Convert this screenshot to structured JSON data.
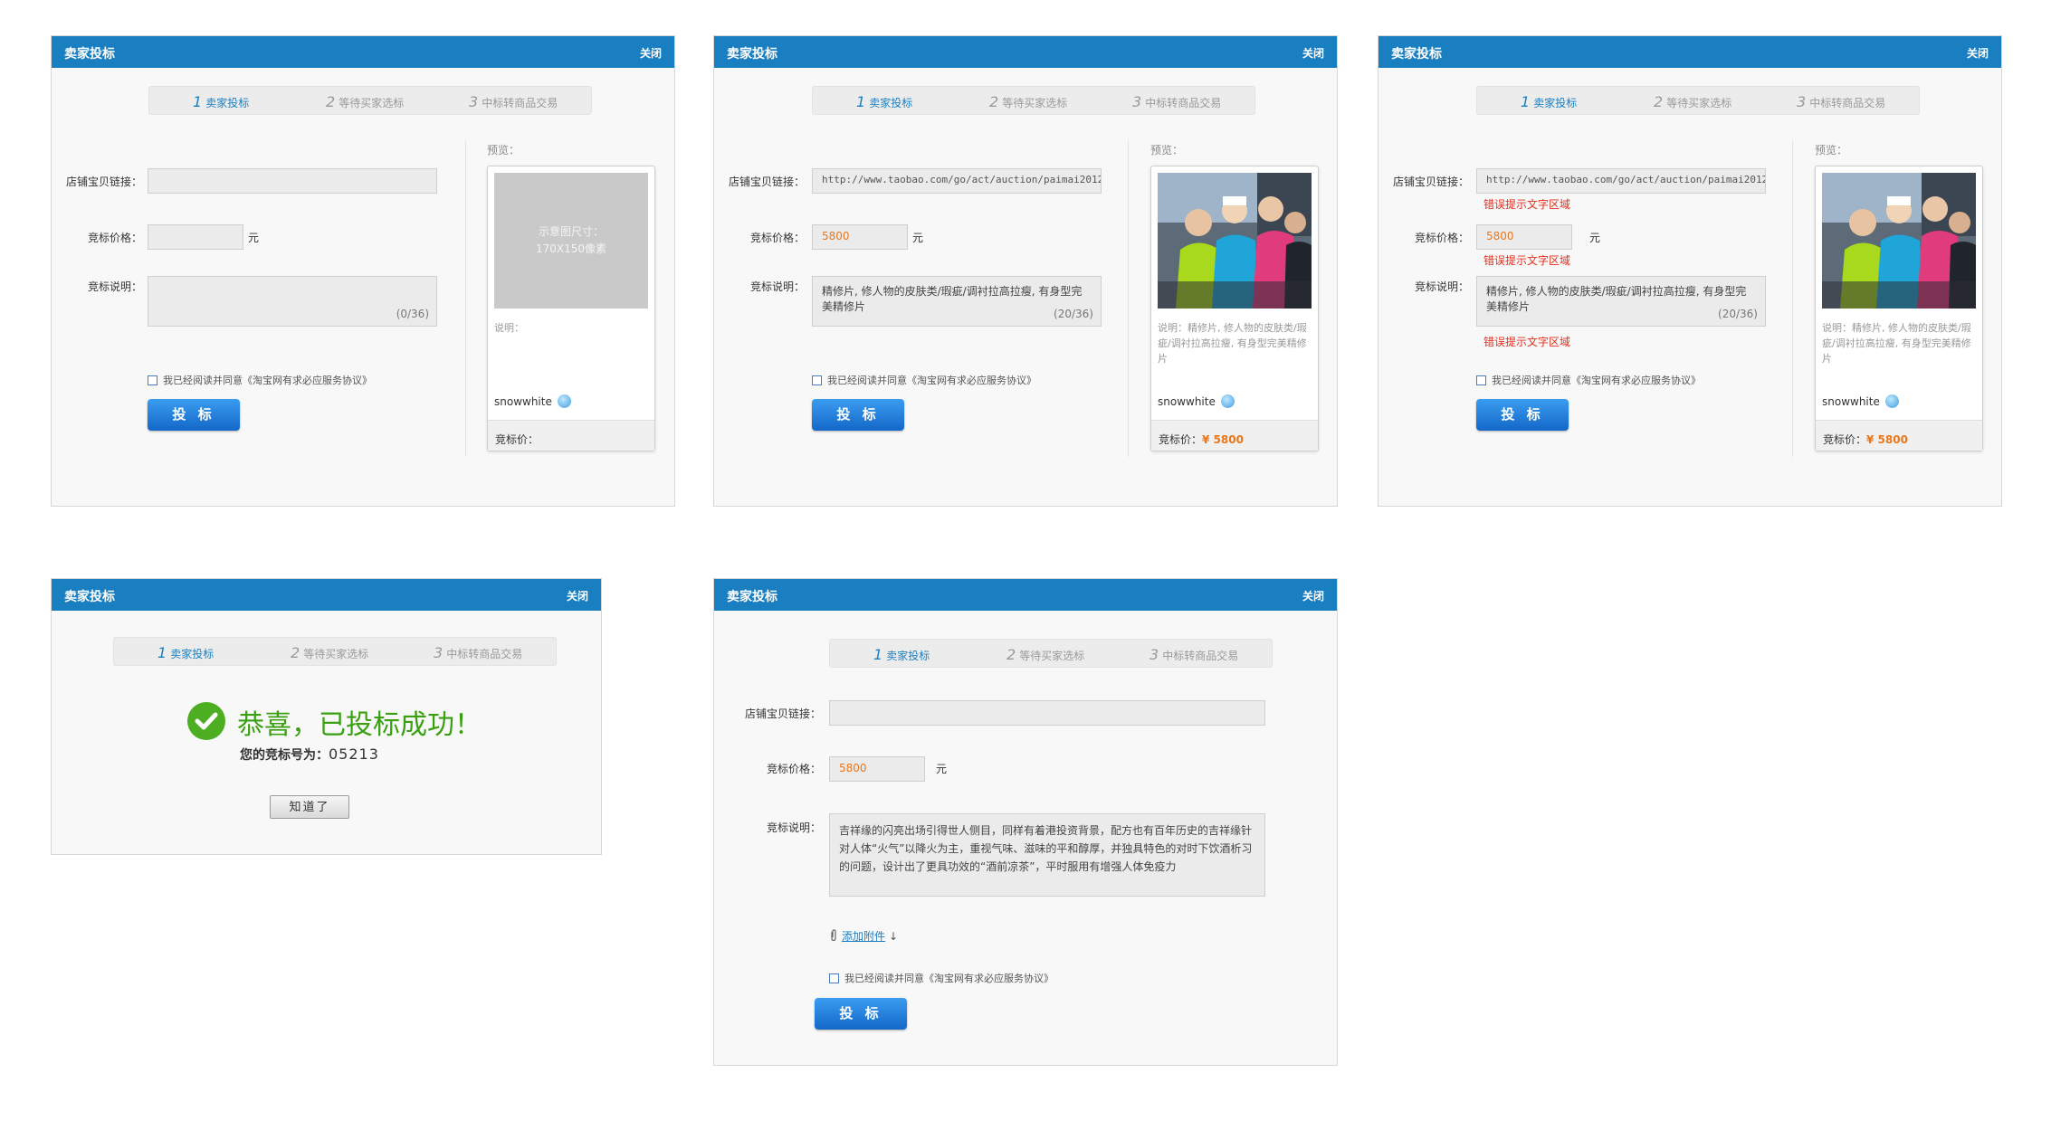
{
  "dialog": {
    "title": "卖家投标",
    "close_label": "关闭",
    "steps": [
      {
        "num": "1",
        "label": "卖家投标"
      },
      {
        "num": "2",
        "label": "等待买家选标"
      },
      {
        "num": "3",
        "label": "中标转商品交易"
      }
    ]
  },
  "form": {
    "link_label": "店铺宝贝链接：",
    "price_label": "竞标价格：",
    "desc_label": "竞标说明：",
    "unit": "元",
    "agree_text": "我已经阅读并同意《淘宝网有求必应服务协议》",
    "submit_label": "投 标",
    "preview_label": "预览：",
    "error_text": "错误提示文字区域",
    "attach_label": "添加附件",
    "attach_arrow": "↓"
  },
  "panel_empty": {
    "link_value": "",
    "price_value": "",
    "desc_value": "",
    "desc_count": "(0/36)",
    "placeholder_line1": "示意图尺寸：",
    "placeholder_line2": "170X150像素",
    "preview_desc": "说明：",
    "preview_user": "snowwhite",
    "preview_price_label": "竞标价：",
    "preview_price_value": ""
  },
  "panel_filled": {
    "link_value": "http://www.taobao.com/go/act/auction/paimai20120",
    "price_value": "5800",
    "desc_value": "精修片, 修人物的皮肤类/瑕疵/调衬拉高拉瘦, 有身型完美精修片",
    "desc_count": "(20/36)",
    "preview_desc": "说明：精修片, 修人物的皮肤类/瑕疵/调衬拉高拉瘦, 有身型完美精修片",
    "preview_user": "snowwhite",
    "preview_price_label": "竞标价：",
    "preview_price_value": "¥ 5800"
  },
  "panel_error": {
    "link_value": "http://www.taobao.com/go/act/auction/paimai20120",
    "price_value": "5800",
    "desc_value": "精修片, 修人物的皮肤类/瑕疵/调衬拉高拉瘦, 有身型完美精修片",
    "desc_count": "(20/36)",
    "preview_desc": "说明：精修片, 修人物的皮肤类/瑕疵/调衬拉高拉瘦, 有身型完美精修片",
    "preview_user": "snowwhite",
    "preview_price_label": "竞标价：",
    "preview_price_value": "¥ 5800"
  },
  "panel_success": {
    "message": "恭喜，已投标成功！",
    "bid_no_label": "您的竞标号为：",
    "bid_no_value": "05213",
    "ok_button": "知道了"
  },
  "panel_attach": {
    "link_value": "",
    "price_value": "5800",
    "desc_value": "吉祥缘的闪亮出场引得世人侧目，同样有着港投资背景，配方也有百年历史的吉祥缘针对人体“火气”以降火为主，重视气味、滋味的平和醇厚，并独具特色的对时下饮酒析习的问题，设计出了更具功效的“酒前凉茶”，平时服用有增强人体免疫力"
  },
  "colors": {
    "titlebar": "#1a7fc1",
    "button": "#1a7fc1",
    "price": "#e8761b",
    "error": "#e0301e",
    "success": "#3aa012"
  },
  "icons": [
    "close-icon",
    "checkbox-icon",
    "user-badge-icon",
    "success-check-icon",
    "paperclip-icon"
  ]
}
